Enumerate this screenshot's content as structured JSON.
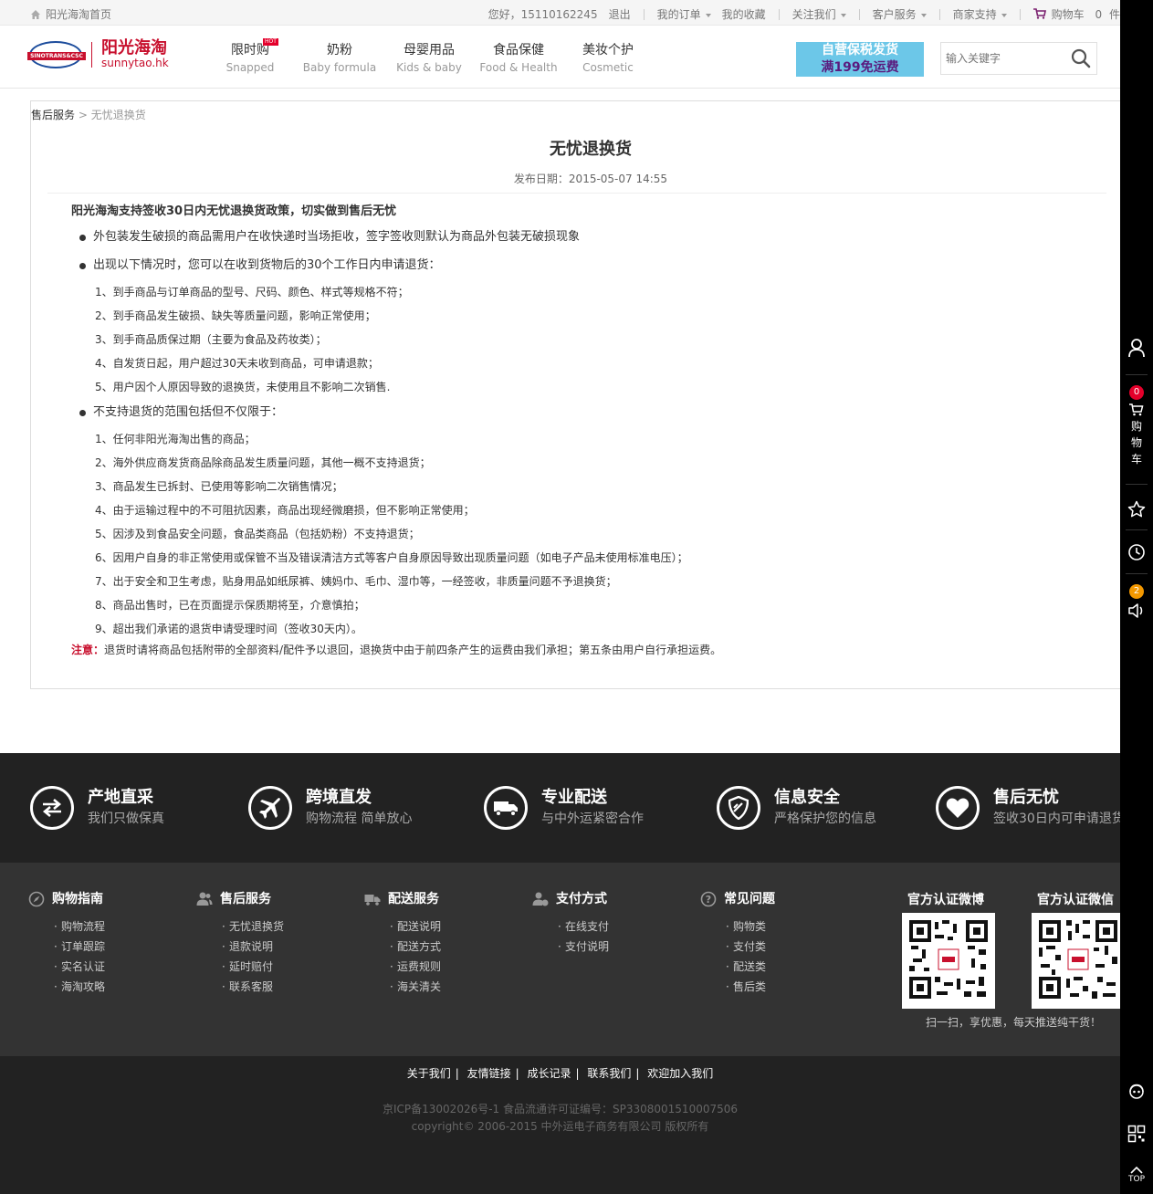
{
  "topbar": {
    "home_label": "阳光海淘首页",
    "greeting": "您好，15110162245",
    "logout": "退出",
    "my_orders": "我的订单",
    "favorites": "我的收藏",
    "follow_us": "关注我们",
    "customer_service": "客户服务",
    "merchant_support": "商家支持",
    "cart_label": "购物车",
    "cart_count": "0",
    "cart_unit": "件"
  },
  "header": {
    "logo_cn": "阳光海淘",
    "logo_en": "sunnytao.hk",
    "logo_band": "SINOTRANS&CSC",
    "nav": [
      {
        "cn": "限时购",
        "en": "Snapped",
        "hot": "HOT"
      },
      {
        "cn": "奶粉",
        "en": "Baby formula"
      },
      {
        "cn": "母婴用品",
        "en": "Kids & baby"
      },
      {
        "cn": "食品保健",
        "en": "Food & Health"
      },
      {
        "cn": "美妆个护",
        "en": "Cosmetic"
      }
    ],
    "promo_line1": "自营保税发货",
    "promo_line2": "满199免运费",
    "search_placeholder": "输入关键字"
  },
  "breadcrumb": {
    "parent": "售后服务",
    "separator": " > ",
    "current": "无忧退换货"
  },
  "article": {
    "title": "无忧退换货",
    "date": "发布日期：2015-05-07 14:55",
    "lead": "阳光海淘支持签收30日内无忧退换货政策，切实做到售后无忧",
    "bullet1": "外包装发生破损的商品需用户在收快递时当场拒收，签字签收则默认为商品外包装无破损现象",
    "bullet2": "出现以下情况时，您可以在收到货物后的30个工作日内申请退货：",
    "list2": [
      "1、到手商品与订单商品的型号、尺码、颜色、样式等规格不符；",
      "2、到手商品发生破损、缺失等质量问题，影响正常使用；",
      "3、到手商品质保过期（主要为食品及药妆类）；",
      "4、自发货日起，用户超过30天未收到商品，可申请退款；",
      "5、用户因个人原因导致的退换货，未使用且不影响二次销售."
    ],
    "bullet3": "不支持退货的范围包括但不仅限于：",
    "list3": [
      "1、任何非阳光海淘出售的商品；",
      "2、海外供应商发货商品除商品发生质量问题，其他一概不支持退货；",
      "3、商品发生已拆封、已使用等影响二次销售情况；",
      "4、由于运输过程中的不可阻抗因素，商品出现经微磨损，但不影响正常使用；",
      "5、因涉及到食品安全问题，食品类商品（包括奶粉）不支持退货；",
      "6、因用户自身的非正常使用或保管不当及错误清洁方式等客户自身原因导致出现质量问题（如电子产品未使用标准电压）；",
      "7、出于安全和卫生考虑，贴身用品如纸尿裤、姨妈巾、毛巾、湿巾等，一经签收，非质量问题不予退换货；",
      "8、商品出售时，已在页面提示保质期将至，介意慎拍；",
      "9、超出我们承诺的退货申请受理时间（签收30天内）。"
    ],
    "note_label": "注意：",
    "note_text": "退货时请将商品包括附带的全部资料/配件予以退回，退换货中由于前四条产生的运费由我们承担；第五条由用户自行承担运费。"
  },
  "sidebar": {
    "cart_badge": "0",
    "cart_text": "购物车",
    "notice_badge": "2",
    "top_label": "TOP"
  },
  "features": [
    {
      "title": "产地直采",
      "sub": "我们只做保真",
      "icon": "exchange-icon"
    },
    {
      "title": "跨境直发",
      "sub": "购物流程 简单放心",
      "icon": "plane-icon"
    },
    {
      "title": "专业配送",
      "sub": "与中外运紧密合作",
      "icon": "truck-icon"
    },
    {
      "title": "信息安全",
      "sub": "严格保护您的信息",
      "icon": "shield-icon"
    },
    {
      "title": "售后无忧",
      "sub": "签收30日内可申请退货",
      "icon": "heart-icon"
    }
  ],
  "footer_cols": [
    {
      "title": "购物指南",
      "items": [
        "购物流程",
        "订单跟踪",
        "实名认证",
        "海淘攻略"
      ]
    },
    {
      "title": "售后服务",
      "items": [
        "无忧退换货",
        "退款说明",
        "延时赔付",
        "联系客服"
      ]
    },
    {
      "title": "配送服务",
      "items": [
        "配送说明",
        "配送方式",
        "运费规则",
        "海关清关"
      ]
    },
    {
      "title": "支付方式",
      "items": [
        "在线支付",
        "支付说明"
      ]
    },
    {
      "title": "常见问题",
      "items": [
        "购物类",
        "支付类",
        "配送类",
        "售后类"
      ]
    }
  ],
  "qr": {
    "weibo_title": "官方认证微博",
    "wechat_title": "官方认证微信",
    "note": "扫一扫，享优惠，每天推送纯干货！"
  },
  "bottom": {
    "links": [
      "关于我们",
      "友情链接",
      "成长记录",
      "联系我们",
      "欢迎加入我们"
    ],
    "icp": "京ICP备13002026号-1  食品流通许可证编号：SP3308001510007506",
    "copyright": "copyright© 2006-2015 中外运电子商务有限公司  版权所有"
  }
}
